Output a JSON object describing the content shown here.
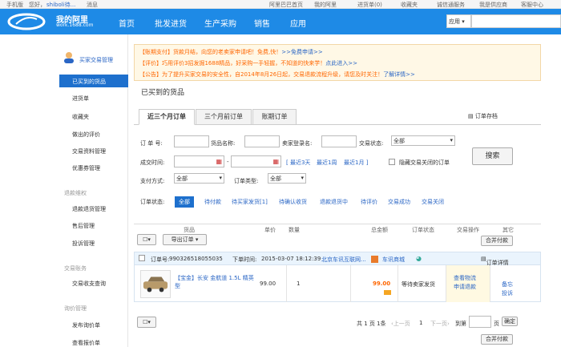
{
  "topbar": {
    "mobile": "手机版",
    "greeting": "您好，",
    "user": "shiboli待...",
    "msg": "消息",
    "alibaba_home": "阿里巴巴首页",
    "my_alibaba": "我的阿里",
    "purchase": "进货单(0)",
    "favorites": "收藏夹",
    "service": "诚信通服务",
    "promo": "我是供应商",
    "customer": "客服中心"
  },
  "header": {
    "logo_title": "我的阿里",
    "logo_sub": "work.1688.com",
    "nav": [
      "首页",
      "批发进货",
      "生产采购",
      "销售",
      "应用"
    ],
    "app_select": "应用"
  },
  "sidebar": {
    "heading": "买家交易管理",
    "items": [
      "已买到的货品",
      "进货单",
      "收藏夹",
      "做出的评价",
      "交易资料管理",
      "优惠券管理"
    ],
    "section2": "退款维权",
    "items2": [
      "退款退货管理",
      "售后管理",
      "投诉管理"
    ],
    "section3": "交易账务",
    "items3": [
      "交易收支查询"
    ],
    "section4": "询价管理",
    "items4": [
      "发布询价单",
      "查看报价单"
    ]
  },
  "notices": [
    {
      "tag": "【账期支付】",
      "text": "货款月结，向您的老卖家申请吧！免费,快！",
      "link": ">>免费申请>>"
    },
    {
      "tag": "【评价】",
      "text": "巧用评价3招发掘1688精品，好采购一手轻握，不知道的快来学！",
      "link": "点此进入>>"
    },
    {
      "tag": "【公告】",
      "text": "为了提升买家交易的安全性，自2014年8月26日起，交易退款流程升级，请您及时关注！",
      "link": "了解详情>>"
    }
  ],
  "page_title": "已买到的货品",
  "tabs": [
    "近三个月订单",
    "三个月前订单",
    "账期订单"
  ],
  "archive": "订单存档",
  "filters": {
    "order_no": "订 单 号:",
    "product": "货品名称:",
    "seller": "卖家登录名:",
    "status": "交易状态:",
    "status_value": "全部",
    "deal_time": "成交时间:",
    "last3days": "最近3天",
    "last_week": "最近1周",
    "last_month": "最近1月",
    "hide_closed": "隐藏交易关闭的订单",
    "pay_way": "支付方式:",
    "pay_value": "全部",
    "order_type": "订单类型:",
    "type_value": "全部",
    "search": "搜索"
  },
  "order_status": {
    "label": "订单状态:",
    "tabs": [
      "全部",
      "待付款",
      "待买家发货[1]",
      "待确认收货",
      "退款退货中",
      "待评价",
      "交易成功",
      "交易关闭"
    ]
  },
  "table_head": [
    "货品",
    "单价",
    "数量",
    "总金额",
    "订单状态",
    "交易操作",
    "其它"
  ],
  "export_btn": "导出订单",
  "merge_pay": "合并付款",
  "order": {
    "no_label": "订单号:",
    "no": "990326518055035",
    "time_label": "下单时间:",
    "time": "2015-03-07 18:12:39",
    "seller": "北京车讯互联网...",
    "shop": "车讯商城",
    "detail": "订单详情",
    "title": "【宝金】长安 金航道 1.5L 精英型",
    "price": "99.00",
    "qty": "1",
    "total": "99.00",
    "status": "等待卖家发货",
    "op1": "查看物流",
    "op2": "申请退款",
    "other1": "备忘",
    "other2": "投诉"
  },
  "pagination": {
    "total": "共 1 页 1条",
    "prev": "上一页",
    "page": "1",
    "next": "下一页",
    "goto": "到第",
    "unit": "页",
    "confirm": "确定"
  }
}
